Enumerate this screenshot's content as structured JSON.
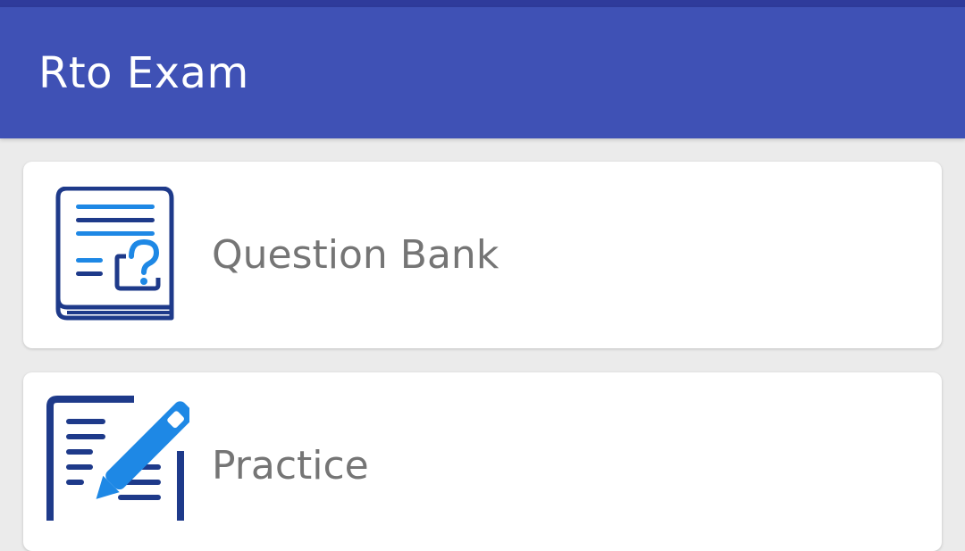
{
  "app_bar": {
    "title": "Rto Exam",
    "color": "#3f51b5",
    "status_color": "#2f3b9b"
  },
  "menu": {
    "items": [
      {
        "label": "Question Bank",
        "icon": "question-bank-icon"
      },
      {
        "label": "Practice",
        "icon": "practice-edit-icon"
      }
    ]
  },
  "colors": {
    "icon_dark": "#1e3a8a",
    "icon_light": "#1e88e5",
    "label": "#757575",
    "background": "#ebebeb"
  }
}
